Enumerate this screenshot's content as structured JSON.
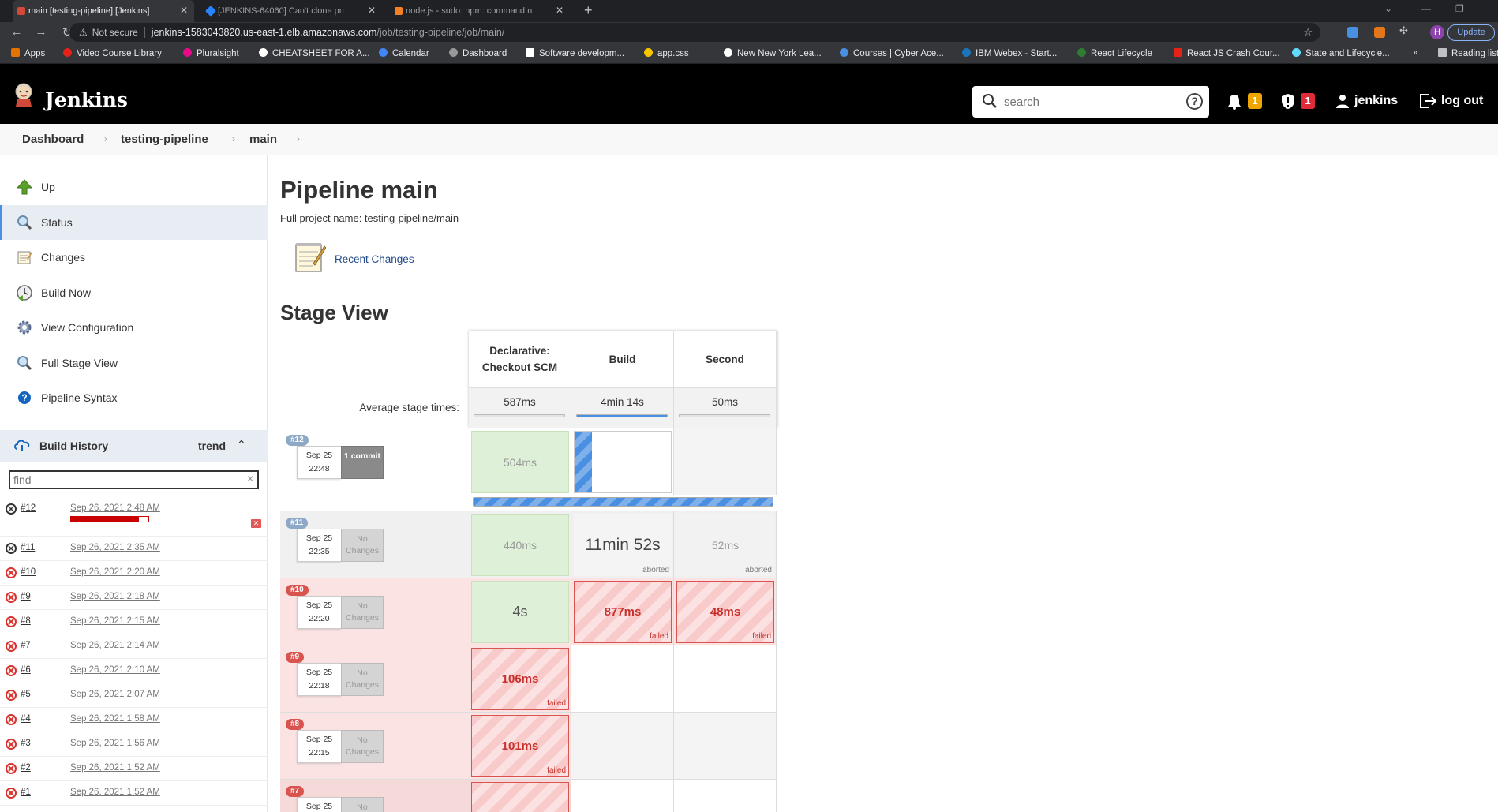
{
  "browser": {
    "tabs": [
      {
        "label": "main [testing-pipeline] [Jenkins]",
        "active": true
      },
      {
        "label": "[JENKINS-64060] Can't clone pri",
        "active": false
      },
      {
        "label": "node.js - sudo: npm: command n",
        "active": false
      }
    ],
    "not_secure": "Not secure",
    "url_host": "jenkins-1583043820.us-east-1.elb.amazonaws.com",
    "url_path": "/job/testing-pipeline/job/main/",
    "profile_initial": "H",
    "update_label": "Update",
    "bookmarks": [
      "Apps",
      "Video Course Library",
      "Pluralsight",
      "CHEATSHEET FOR A...",
      "Calendar",
      "Dashboard",
      "Software developm...",
      "app.css",
      "New New York Lea...",
      "Courses | Cyber Ace...",
      "IBM Webex - Start...",
      "React Lifecycle",
      "React JS Crash Cour...",
      "State and Lifecycle...",
      "»",
      "Reading list"
    ]
  },
  "header": {
    "title": "Jenkins",
    "search_placeholder": "search",
    "help": "?",
    "notifications_count": "1",
    "security_count": "1",
    "user": "jenkins",
    "logout": "log out"
  },
  "breadcrumb": [
    "Dashboard",
    "testing-pipeline",
    "main"
  ],
  "sidebar": {
    "tasks": [
      {
        "label": "Up",
        "icon": "up-arrow-icon"
      },
      {
        "label": "Status",
        "icon": "magnifier-icon"
      },
      {
        "label": "Changes",
        "icon": "notepad-icon"
      },
      {
        "label": "Build Now",
        "icon": "build-clock-icon"
      },
      {
        "label": "View Configuration",
        "icon": "gear-icon"
      },
      {
        "label": "Full Stage View",
        "icon": "magnifier-icon"
      },
      {
        "label": "Pipeline Syntax",
        "icon": "help-icon"
      }
    ],
    "build_history": {
      "title": "Build History",
      "trend": "trend",
      "find_placeholder": "find",
      "builds": [
        {
          "num": "#12",
          "date": "Sep 26, 2021 2:48 AM",
          "status": "running",
          "progress": 0.88
        },
        {
          "num": "#11",
          "date": "Sep 26, 2021 2:35 AM",
          "status": "aborted"
        },
        {
          "num": "#10",
          "date": "Sep 26, 2021 2:20 AM",
          "status": "failed"
        },
        {
          "num": "#9",
          "date": "Sep 26, 2021 2:18 AM",
          "status": "failed"
        },
        {
          "num": "#8",
          "date": "Sep 26, 2021 2:15 AM",
          "status": "failed"
        },
        {
          "num": "#7",
          "date": "Sep 26, 2021 2:14 AM",
          "status": "failed"
        },
        {
          "num": "#6",
          "date": "Sep 26, 2021 2:10 AM",
          "status": "failed"
        },
        {
          "num": "#5",
          "date": "Sep 26, 2021 2:07 AM",
          "status": "failed"
        },
        {
          "num": "#4",
          "date": "Sep 26, 2021 1:58 AM",
          "status": "failed"
        },
        {
          "num": "#3",
          "date": "Sep 26, 2021 1:56 AM",
          "status": "failed"
        },
        {
          "num": "#2",
          "date": "Sep 26, 2021 1:52 AM",
          "status": "failed"
        },
        {
          "num": "#1",
          "date": "Sep 26, 2021 1:52 AM",
          "status": "failed"
        }
      ]
    }
  },
  "main": {
    "title": "Pipeline main",
    "full_name": "Full project name: testing-pipeline/main",
    "recent_changes": "Recent Changes",
    "stage_view_title": "Stage View",
    "avg_label": "Average stage times:",
    "stages": [
      {
        "name": "Declarative: Checkout SCM",
        "avg": "587ms",
        "avg_fraction": 0.0
      },
      {
        "name": "Build",
        "avg": "4min 14s",
        "avg_fraction": 1.0
      },
      {
        "name": "Second",
        "avg": "50ms",
        "avg_fraction": 0.0
      }
    ],
    "runs": [
      {
        "num": "#12",
        "date": "Sep 25",
        "time": "22:48",
        "changes": "1 commit",
        "has_commit": true,
        "cells": [
          {
            "text": "504ms",
            "state": "ok"
          },
          {
            "text": "",
            "state": "running"
          },
          {
            "text": "",
            "state": "empty"
          }
        ],
        "running": true
      },
      {
        "num": "#11",
        "date": "Sep 25",
        "time": "22:35",
        "changes": "No Changes",
        "has_commit": false,
        "cells": [
          {
            "text": "440ms",
            "state": "ok"
          },
          {
            "text": "11min 52s",
            "state": "abortbig",
            "sub": "aborted"
          },
          {
            "text": "52ms",
            "state": "aborted",
            "sub": "aborted"
          }
        ]
      },
      {
        "num": "#10",
        "date": "Sep 25",
        "time": "22:20",
        "changes": "No Changes",
        "has_commit": false,
        "cells": [
          {
            "text": "4s",
            "state": "okbig"
          },
          {
            "text": "877ms",
            "state": "fail",
            "sub": "failed"
          },
          {
            "text": "48ms",
            "state": "fail",
            "sub": "failed"
          }
        ]
      },
      {
        "num": "#9",
        "date": "Sep 25",
        "time": "22:18",
        "changes": "No Changes",
        "has_commit": false,
        "cells": [
          {
            "text": "106ms",
            "state": "fail",
            "sub": "failed"
          },
          {
            "text": "",
            "state": "empty"
          },
          {
            "text": "",
            "state": "empty"
          }
        ]
      },
      {
        "num": "#8",
        "date": "Sep 25",
        "time": "22:15",
        "changes": "No Changes",
        "has_commit": false,
        "cells": [
          {
            "text": "101ms",
            "state": "fail",
            "sub": "failed"
          },
          {
            "text": "",
            "state": "empty"
          },
          {
            "text": "",
            "state": "empty"
          }
        ]
      },
      {
        "num": "#7",
        "date": "Sep 25",
        "time": "",
        "changes": "No",
        "has_commit": false,
        "cells": [
          {
            "text": "",
            "state": "fail"
          },
          {
            "text": "",
            "state": "empty"
          },
          {
            "text": "",
            "state": "empty"
          }
        ]
      }
    ]
  },
  "colors": {
    "header_bg": "#000000",
    "accent_blue": "#4a90e2",
    "fail_red": "#c9302c",
    "success_green": "#dff0d8",
    "badge_orange": "#f0a500",
    "badge_red": "#e02b38"
  }
}
